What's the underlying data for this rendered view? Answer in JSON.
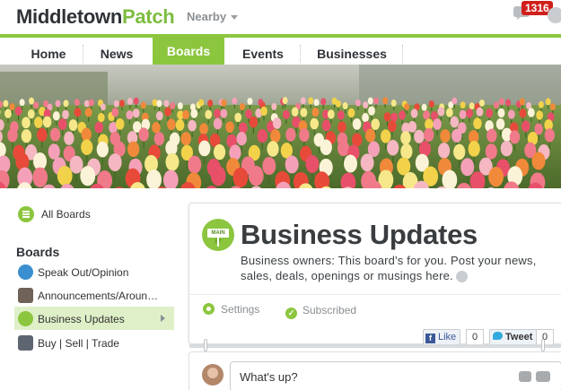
{
  "header": {
    "site_name_part1": "Middletown",
    "site_name_part2": "Patch",
    "nearby_label": "Nearby",
    "notification_count": "1316"
  },
  "nav": {
    "items": [
      {
        "label": "Home"
      },
      {
        "label": "News"
      },
      {
        "label": "Boards",
        "active": true
      },
      {
        "label": "Events"
      },
      {
        "label": "Businesses"
      }
    ]
  },
  "sidebar": {
    "all_boards": "All Boards",
    "boards_heading": "Boards",
    "items": [
      {
        "label": "Speak Out/Opinion"
      },
      {
        "label": "Announcements/Aroun…"
      },
      {
        "label": "Business Updates",
        "active": true
      },
      {
        "label": "Buy | Sell | Trade"
      }
    ]
  },
  "board": {
    "badge": "MAIN ST",
    "title": "Business Updates",
    "description": "Business owners: This board's for you. Post your news, sales, deals, openings or musings here.",
    "settings_label": "Settings",
    "subscribed_label": "Subscribed"
  },
  "social": {
    "like_label": "Like",
    "like_count": "0",
    "tweet_label": "Tweet",
    "tweet_count": "0"
  },
  "composer": {
    "placeholder": "What's up?"
  },
  "colors": {
    "accent_green": "#8cc63f",
    "badge_red": "#d0201c"
  }
}
